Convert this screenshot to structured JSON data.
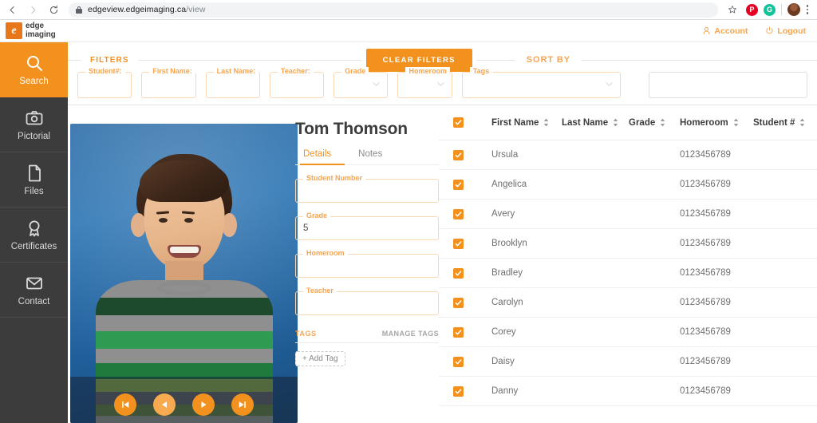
{
  "browser": {
    "back_icon": "back-arrow-icon",
    "forward_icon": "forward-arrow-icon",
    "reload_icon": "reload-icon",
    "lock_icon": "lock-icon",
    "url_domain": "edgeview.edgeimaging.ca",
    "url_path": "/view",
    "star_icon": "bookmark-star-icon",
    "extensions": [
      {
        "name": "pinterest-extension-icon",
        "glyph": "P",
        "color": "#e60023"
      },
      {
        "name": "grammarly-extension-icon",
        "glyph": "G",
        "color": "#15c39a"
      }
    ],
    "profile_icon": "profile-avatar-icon",
    "menu_icon": "chrome-menu-icon"
  },
  "header": {
    "logo_text_line1": "edge",
    "logo_text_line2": "imaging",
    "logo_glyph": "e",
    "account_label": "Account",
    "account_icon": "person-icon",
    "logout_label": "Logout",
    "logout_icon": "power-icon"
  },
  "sidebar": {
    "items": [
      {
        "label": "Search",
        "icon": "search-icon",
        "active": true
      },
      {
        "label": "Pictorial",
        "icon": "camera-icon",
        "active": false
      },
      {
        "label": "Files",
        "icon": "file-icon",
        "active": false
      },
      {
        "label": "Certificates",
        "icon": "award-icon",
        "active": false
      },
      {
        "label": "Contact",
        "icon": "envelope-icon",
        "active": false
      }
    ]
  },
  "filters": {
    "section_label": "FILTERS",
    "clear_label": "CLEAR FILTERS",
    "sort_label": "SORT BY",
    "fields": [
      {
        "label": "Student#:",
        "value": "",
        "type": "text"
      },
      {
        "label": "First Name:",
        "value": "",
        "type": "text"
      },
      {
        "label": "Last Name:",
        "value": "",
        "type": "text"
      },
      {
        "label": "Teacher:",
        "value": "",
        "type": "text"
      },
      {
        "label": "Grade",
        "value": "",
        "type": "select"
      },
      {
        "label": "Homeroom",
        "value": "",
        "type": "select"
      },
      {
        "label": "Tags",
        "value": "",
        "type": "select"
      }
    ],
    "sort_value": ""
  },
  "photo": {
    "nav_first_icon": "skip-to-first-icon",
    "nav_prev_icon": "previous-icon",
    "nav_play_icon": "play-icon",
    "nav_last_icon": "skip-to-last-icon",
    "subject_alt": "student-portrait-photo"
  },
  "details": {
    "student_name": "Tom Thomson",
    "tabs": [
      {
        "label": "Details",
        "active": true
      },
      {
        "label": "Notes",
        "active": false
      }
    ],
    "fields": [
      {
        "label": "Student Number",
        "value": ""
      },
      {
        "label": "Grade",
        "value": "5"
      },
      {
        "label": "Homeroom",
        "value": ""
      },
      {
        "label": "Teacher",
        "value": ""
      }
    ],
    "tags_title": "TAGS",
    "manage_tags_label": "MANAGE TAGS",
    "add_tag_label": "+ Add Tag"
  },
  "table": {
    "select_all_checked": true,
    "columns": [
      {
        "key": "first_name",
        "label": "First Name",
        "sortable": true
      },
      {
        "key": "last_name",
        "label": "Last Name",
        "sortable": true
      },
      {
        "key": "grade",
        "label": "Grade",
        "sortable": true
      },
      {
        "key": "homeroom",
        "label": "Homeroom",
        "sortable": true
      },
      {
        "key": "student_number",
        "label": "Student #",
        "sortable": true
      }
    ],
    "rows": [
      {
        "checked": true,
        "first_name": "Ursula",
        "last_name": "",
        "grade": "",
        "homeroom": "0123456789",
        "student_number": ""
      },
      {
        "checked": true,
        "first_name": "Angelica",
        "last_name": "",
        "grade": "",
        "homeroom": "0123456789",
        "student_number": ""
      },
      {
        "checked": true,
        "first_name": "Avery",
        "last_name": "",
        "grade": "",
        "homeroom": "0123456789",
        "student_number": ""
      },
      {
        "checked": true,
        "first_name": "Brooklyn",
        "last_name": "",
        "grade": "",
        "homeroom": "0123456789",
        "student_number": ""
      },
      {
        "checked": true,
        "first_name": "Bradley",
        "last_name": "",
        "grade": "",
        "homeroom": "0123456789",
        "student_number": ""
      },
      {
        "checked": true,
        "first_name": "Carolyn",
        "last_name": "",
        "grade": "",
        "homeroom": "0123456789",
        "student_number": ""
      },
      {
        "checked": true,
        "first_name": "Corey",
        "last_name": "",
        "grade": "",
        "homeroom": "0123456789",
        "student_number": ""
      },
      {
        "checked": true,
        "first_name": "Daisy",
        "last_name": "",
        "grade": "",
        "homeroom": "0123456789",
        "student_number": ""
      },
      {
        "checked": true,
        "first_name": "Danny",
        "last_name": "",
        "grade": "",
        "homeroom": "0123456789",
        "student_number": ""
      }
    ]
  },
  "colors": {
    "brand_orange": "#f2911e",
    "brand_orange_light": "#f5a54f",
    "sidebar_dark": "#3c3c3c",
    "text_dark": "#3d3d3d",
    "text_muted": "#6f6f6f"
  }
}
